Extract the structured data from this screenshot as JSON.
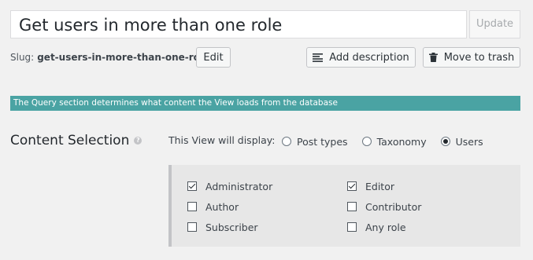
{
  "title_field": {
    "value": "Get users in more than one role"
  },
  "update_button": {
    "label": "Update"
  },
  "slug": {
    "label": "Slug:",
    "value": "get-users-in-more-than-one-role"
  },
  "edit_button": {
    "label": "Edit"
  },
  "description_button": {
    "label": "Add description",
    "icon": "lines-icon"
  },
  "trash_button": {
    "label": "Move to trash",
    "icon": "trash-icon"
  },
  "info_bar": {
    "text": "The Query section determines what content the View loads from the database",
    "color": "#4aa3a3"
  },
  "content_selection": {
    "title": "Content Selection",
    "display_label": "This View will display:",
    "options": [
      {
        "label": "Post types",
        "checked": false
      },
      {
        "label": "Taxonomy",
        "checked": false
      },
      {
        "label": "Users",
        "checked": true
      }
    ]
  },
  "roles": [
    {
      "label": "Administrator",
      "checked": true
    },
    {
      "label": "Editor",
      "checked": true
    },
    {
      "label": "Author",
      "checked": false
    },
    {
      "label": "Contributor",
      "checked": false
    },
    {
      "label": "Subscriber",
      "checked": false
    },
    {
      "label": "Any role",
      "checked": false
    }
  ]
}
